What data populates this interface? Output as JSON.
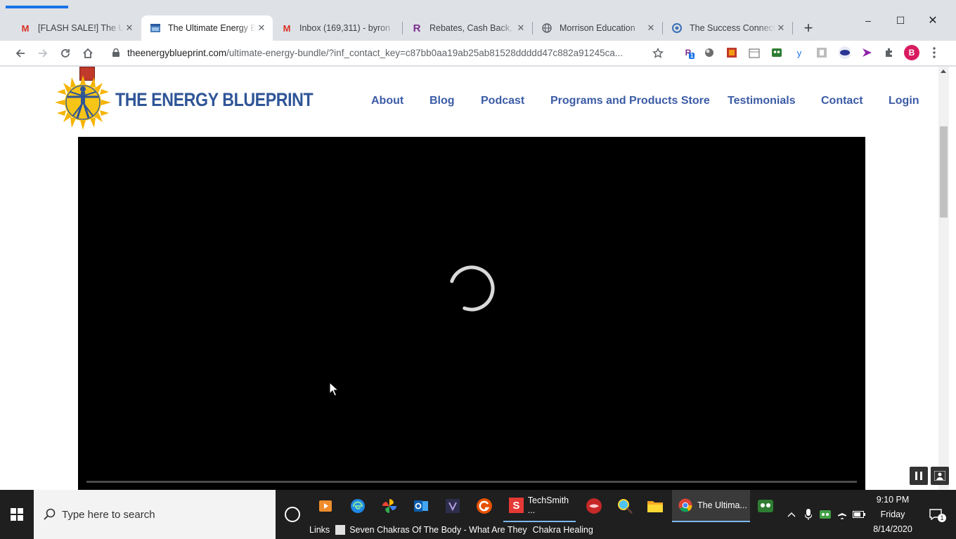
{
  "browser": {
    "tabs": [
      {
        "label": "[FLASH SALE!] The Ultimate Energy Bundle",
        "icon": "gmail-icon",
        "color": "#d93025"
      },
      {
        "label": "The Ultimate Energy Bundle",
        "icon": "site-icon",
        "color": "#4a7ebb",
        "active": true
      },
      {
        "label": "Inbox (169,311) - byron",
        "icon": "gmail-icon",
        "color": "#d93025"
      },
      {
        "label": "Rebates, Cash Back, Discounts",
        "icon": "rakuten-icon",
        "color": "#7b2d8e"
      },
      {
        "label": "Morrison Education",
        "icon": "globe-icon",
        "color": "#5f6368"
      },
      {
        "label": "The Success Connection",
        "icon": "success-icon",
        "color": "#3b6fb6"
      }
    ],
    "tab_letters": {
      "gmail": "M",
      "rakuten": "R"
    },
    "close_glyph": "✕",
    "new_tab_glyph": "+",
    "window": {
      "minimize": "–",
      "maximize": "☐",
      "close": "✕"
    },
    "url_host": "theenergyblueprint.com",
    "url_path": "/ultimate-energy-bundle/?inf_contact_key=c87bb0aa19ab25ab81528ddddd47c882a91245ca...",
    "profile_letter": "B",
    "ext_badge": "1",
    "ext_letters": {
      "rakuten": "R",
      "yahoo": "y"
    }
  },
  "site": {
    "brand": "THE ENERGY BLUEPRINT",
    "nav": [
      "About",
      "Blog",
      "Podcast",
      "Programs and Products Store",
      "Testimonials",
      "Contact",
      "Login"
    ]
  },
  "taskbar": {
    "search_placeholder": "Type here to search",
    "apps": [
      {
        "label": "TechSmith ...",
        "icon": "techsmith-icon",
        "letter": "S"
      },
      {
        "label": "The Ultima...",
        "icon": "chrome-icon",
        "active": true
      }
    ],
    "links_label": "Links",
    "links": [
      "Seven Chakras Of The Body - What Are They",
      "Chakra Healing"
    ],
    "time": "9:10 PM",
    "day": "Friday",
    "date": "8/14/2020",
    "notif_count": "1"
  },
  "colors": {
    "brand_blue": "#2f5597",
    "nav_blue": "#3b5ba5",
    "chrome_bg": "#dee1e6",
    "taskbar": "#1f1f1f"
  }
}
